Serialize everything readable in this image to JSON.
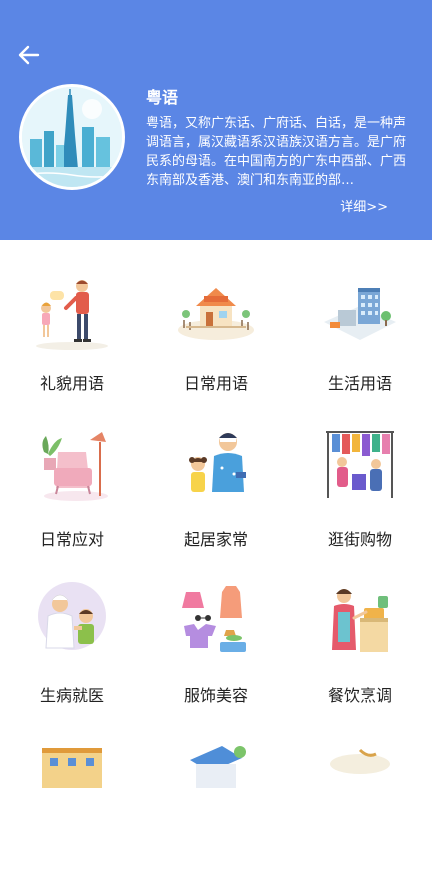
{
  "header": {
    "title": "粤语",
    "description": "粤语，又称广东话、广府话、白话，是一种声调语言，属汉藏语系汉语族汉语方言。是广府民系的母语。在中国南方的广东中西部、广西东南部及香港、澳门和东南亚的部…",
    "detail_link": "详细>>",
    "back_icon": "arrow-left-icon",
    "accent_color": "#5b86e5"
  },
  "categories": [
    {
      "label": "礼貌用语",
      "icon": "greeting-people-icon"
    },
    {
      "label": "日常用语",
      "icon": "house-scene-icon"
    },
    {
      "label": "生活用语",
      "icon": "city-building-icon"
    },
    {
      "label": "日常应对",
      "icon": "armchair-lamp-icon"
    },
    {
      "label": "起居家常",
      "icon": "father-daughter-icon"
    },
    {
      "label": "逛街购物",
      "icon": "clothing-rack-icon"
    },
    {
      "label": "生病就医",
      "icon": "nurse-patient-icon"
    },
    {
      "label": "服饰美容",
      "icon": "clothes-icon"
    },
    {
      "label": "餐饮烹调",
      "icon": "cooking-woman-icon"
    }
  ]
}
